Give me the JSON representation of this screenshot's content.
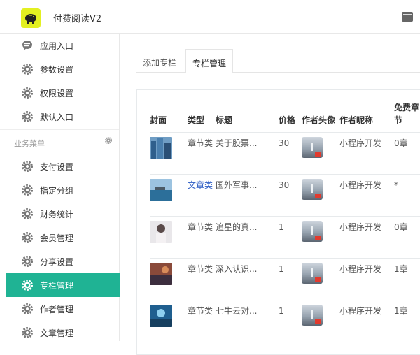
{
  "app": {
    "title": "付费阅读V2"
  },
  "sidebar": {
    "items_top": [
      {
        "label": "应用入口",
        "icon": "chat-bubble-icon"
      },
      {
        "label": "参数设置",
        "icon": "gear-icon"
      },
      {
        "label": "权限设置",
        "icon": "gear-icon"
      },
      {
        "label": "默认入口",
        "icon": "gear-icon"
      }
    ],
    "section_label": "业务菜单",
    "items_business": [
      {
        "label": "支付设置",
        "icon": "gear-icon"
      },
      {
        "label": "指定分组",
        "icon": "gear-icon"
      },
      {
        "label": "财务统计",
        "icon": "gear-icon"
      },
      {
        "label": "会员管理",
        "icon": "gear-icon"
      },
      {
        "label": "分享设置",
        "icon": "gear-icon"
      },
      {
        "label": "专栏管理",
        "icon": "gear-icon",
        "active": true
      },
      {
        "label": "作者管理",
        "icon": "gear-icon"
      },
      {
        "label": "文章管理",
        "icon": "gear-icon"
      }
    ]
  },
  "tabs": [
    {
      "label": "添加专栏",
      "active": false
    },
    {
      "label": "专栏管理",
      "active": true
    }
  ],
  "table": {
    "headers": {
      "cover": "封面",
      "type": "类型",
      "title": "标题",
      "price": "价格",
      "avatar": "作者头像",
      "nickname": "作者昵称",
      "free": "免费章节"
    },
    "rows": [
      {
        "type": "章节类",
        "title": "关于股票...",
        "price": "30",
        "nickname": "小程序开发",
        "free": "0章",
        "type_link": false
      },
      {
        "type": "文章类",
        "title": "国外军事...",
        "price": "30",
        "nickname": "小程序开发",
        "free": "*",
        "type_link": true
      },
      {
        "type": "章节类",
        "title": "追星的真...",
        "price": "1",
        "nickname": "小程序开发",
        "free": "0章",
        "type_link": false
      },
      {
        "type": "章节类",
        "title": "深入认识...",
        "price": "1",
        "nickname": "小程序开发",
        "free": "1章",
        "type_link": false
      },
      {
        "type": "章节类",
        "title": "七牛云对...",
        "price": "1",
        "nickname": "小程序开发",
        "free": "1章",
        "type_link": false
      }
    ]
  },
  "colors": {
    "accent": "#1fb394",
    "logo_bg": "#e3f021",
    "link": "#2c5cc5"
  }
}
